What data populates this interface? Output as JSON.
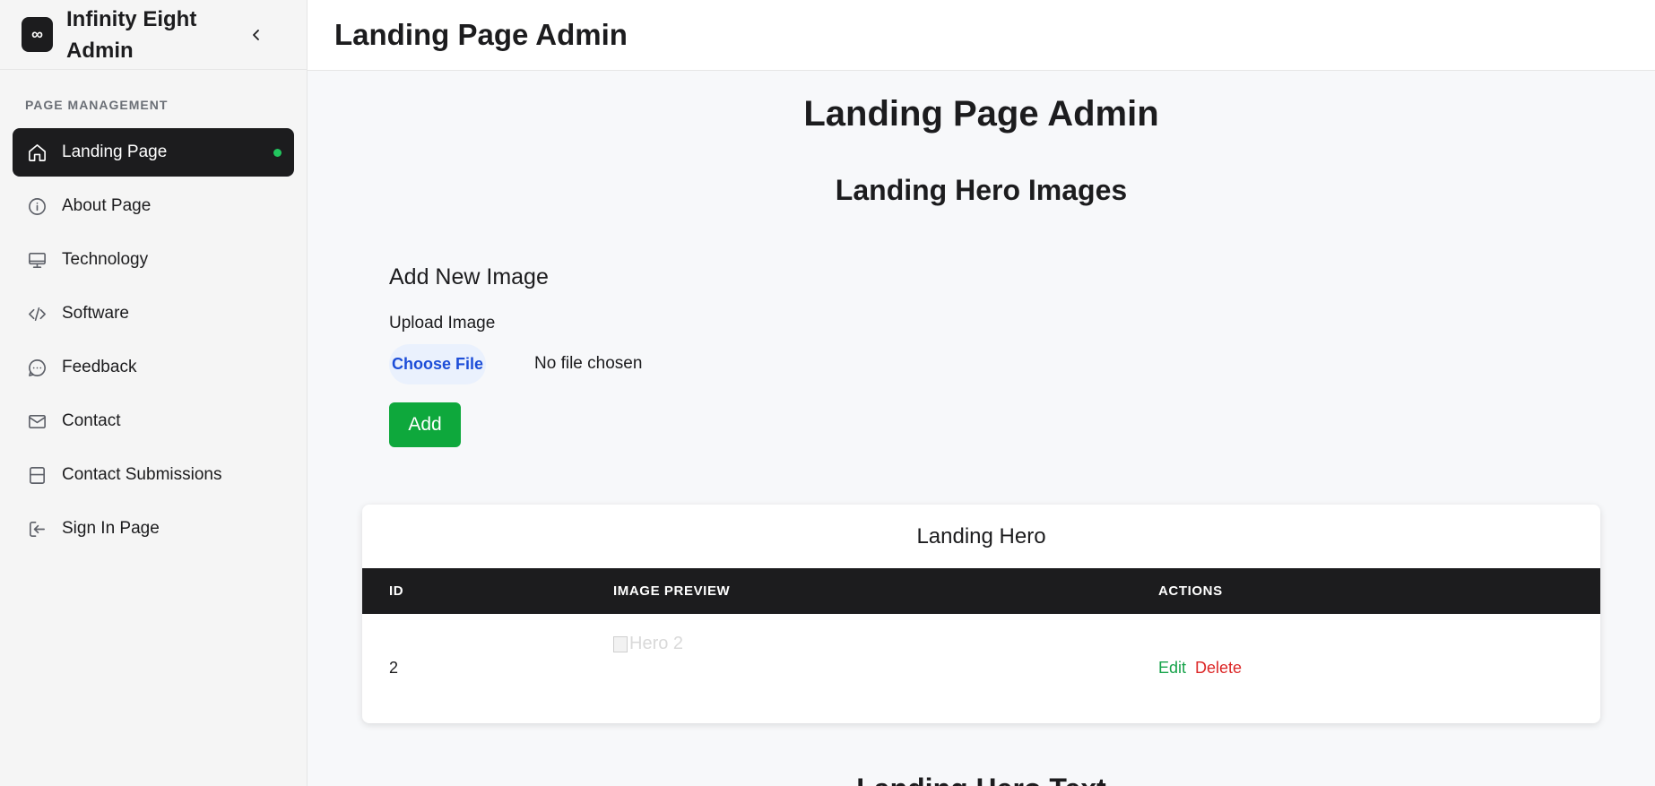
{
  "brand": {
    "logo": "∞",
    "name": "Infinity Eight Admin"
  },
  "sidebar": {
    "section_label": "PAGE MANAGEMENT",
    "items": [
      {
        "label": "Landing Page",
        "icon": "home-icon",
        "active": true
      },
      {
        "label": "About Page",
        "icon": "info-icon"
      },
      {
        "label": "Technology",
        "icon": "monitor-icon"
      },
      {
        "label": "Software",
        "icon": "code-icon"
      },
      {
        "label": "Feedback",
        "icon": "message-icon"
      },
      {
        "label": "Contact",
        "icon": "mail-icon"
      },
      {
        "label": "Contact Submissions",
        "icon": "archive-icon"
      },
      {
        "label": "Sign In Page",
        "icon": "sign-in-icon"
      }
    ]
  },
  "header": {
    "title": "Landing Page Admin"
  },
  "main": {
    "page_heading": "Landing Page Admin",
    "section_heading": "Landing Hero Images",
    "form": {
      "title": "Add New Image",
      "upload_label": "Upload Image",
      "choose_file_label": "Choose File",
      "file_status": "No file chosen",
      "add_label": "Add"
    },
    "table": {
      "title": "Landing Hero",
      "columns": [
        "ID",
        "IMAGE PREVIEW",
        "ACTIONS"
      ],
      "rows": [
        {
          "id": "2",
          "image_alt": "Hero 2",
          "edit_label": "Edit",
          "delete_label": "Delete"
        }
      ]
    },
    "next_section_heading": "Landing Hero Text"
  },
  "colors": {
    "accent": "#1c1c1e",
    "active_dot": "#22c55e",
    "add_button": "#0ea83c",
    "edit": "#16a34a",
    "delete": "#dc2626",
    "file_button_text": "#1d4ed8"
  }
}
